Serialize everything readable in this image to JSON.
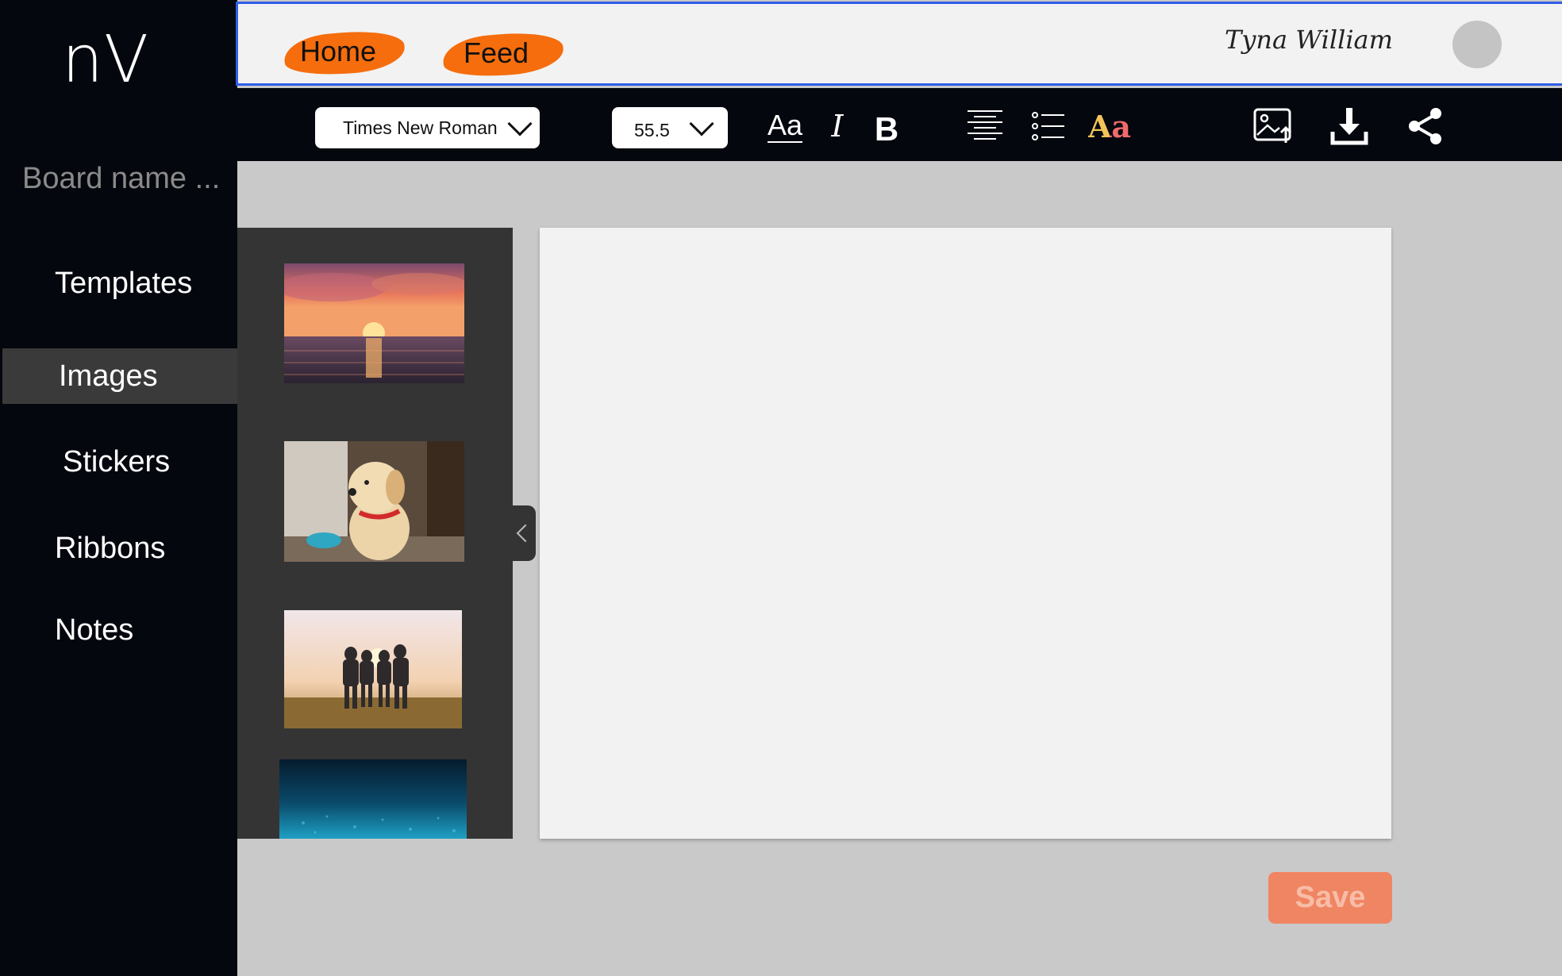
{
  "app": {
    "logo": "nV"
  },
  "sidebar": {
    "board_name_placeholder": "Board name ...",
    "items": [
      {
        "label": "Templates",
        "active": false
      },
      {
        "label": "Images",
        "active": true
      },
      {
        "label": "Stickers",
        "active": false
      },
      {
        "label": "Ribbons",
        "active": false
      },
      {
        "label": "Notes",
        "active": false
      }
    ]
  },
  "header": {
    "links": [
      {
        "label": "Home"
      },
      {
        "label": "Feed"
      }
    ],
    "user_name": "Tyna William",
    "accent_color": "#f56d0d"
  },
  "toolbar": {
    "font_family_value": "Times New Roman",
    "font_size_value": "55.5",
    "text_style_glyph": "Aa",
    "italic_glyph": "I",
    "bold_glyph": "B",
    "color_glyph": "Aa",
    "icons": [
      "text-style-icon",
      "italic-icon",
      "bold-icon",
      "align-center-icon",
      "bullet-list-icon",
      "text-color-icon",
      "upload-image-icon",
      "download-icon",
      "share-icon"
    ]
  },
  "image_panel": {
    "images": [
      "sunset-over-sea",
      "golden-retriever-puppy",
      "friends-at-sunset",
      "underwater-blue"
    ]
  },
  "actions": {
    "save_label": "Save"
  }
}
